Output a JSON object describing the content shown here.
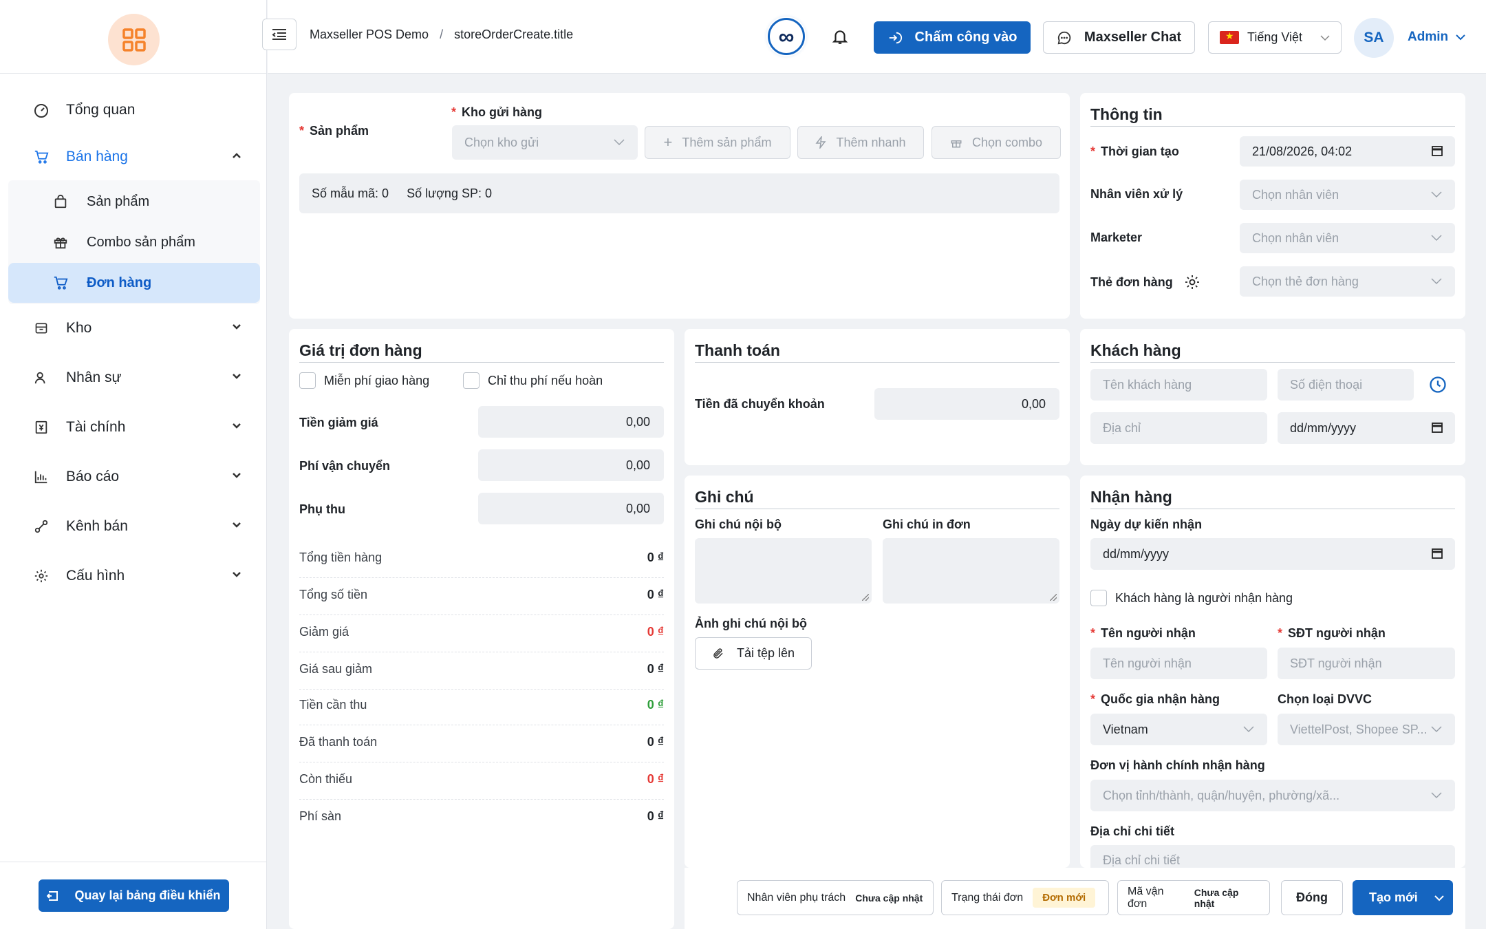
{
  "sidebar": {
    "items": [
      {
        "label": "Tổng quan",
        "icon": "dashboard-icon"
      },
      {
        "label": "Bán hàng",
        "icon": "cart-icon"
      },
      {
        "label": "Kho",
        "icon": "box-icon"
      },
      {
        "label": "Nhân sự",
        "icon": "users-icon"
      },
      {
        "label": "Tài chính",
        "icon": "finance-icon"
      },
      {
        "label": "Báo cáo",
        "icon": "chart-icon"
      },
      {
        "label": "Kênh bán",
        "icon": "channel-icon"
      },
      {
        "label": "Cấu hình",
        "icon": "gear-icon"
      }
    ],
    "sub_items": [
      {
        "label": "Sản phẩm",
        "icon": "bag-icon"
      },
      {
        "label": "Combo sản phẩm",
        "icon": "gift-icon"
      },
      {
        "label": "Đơn hàng",
        "icon": "cart-icon"
      }
    ],
    "back_label": "Quay lại bảng điều khiển"
  },
  "header": {
    "breadcrumb": [
      "Maxseller POS Demo",
      "/",
      "storeOrderCreate.title"
    ],
    "infinity": "∞",
    "checkin_label": "Chấm công vào",
    "chat_label": "Maxseller Chat",
    "language": "Tiếng Việt",
    "avatar_initials": "SA",
    "user_name": "Admin"
  },
  "product": {
    "label": "Sản phẩm",
    "warehouse_label": "Kho gửi hàng",
    "warehouse_placeholder": "Chọn kho gửi",
    "add_product": "Thêm sản phẩm",
    "quick_add": "Thêm nhanh",
    "choose_combo": "Chọn combo",
    "sku_count": "Số mẫu mã: 0",
    "qty_count": "Số lượng SP: 0"
  },
  "info": {
    "title": "Thông tin",
    "created_label": "Thời gian tạo",
    "created_value": "21/08/2026, 04:02",
    "handler_label": "Nhân viên xử lý",
    "handler_placeholder": "Chọn nhân viên",
    "marketer_label": "Marketer",
    "marketer_placeholder": "Chọn nhân viên",
    "tag_label": "Thẻ đơn hàng",
    "tag_placeholder": "Chọn thẻ đơn hàng"
  },
  "order_value": {
    "title": "Giá trị đơn hàng",
    "free_ship": "Miễn phí giao hàng",
    "charge_on_return": "Chỉ thu phí nếu hoàn",
    "discount_label": "Tiền giảm giá",
    "discount_value": "0,00",
    "shipping_label": "Phí vận chuyển",
    "shipping_value": "0,00",
    "surcharge_label": "Phụ thu",
    "surcharge_value": "0,00",
    "summary": [
      {
        "label": "Tổng tiền hàng",
        "value": "0 ₫",
        "color": "#1f2328"
      },
      {
        "label": "Tổng số tiền",
        "value": "0 ₫",
        "color": "#1f2328"
      },
      {
        "label": "Giảm giá",
        "value": "0 ₫",
        "color": "#e53935"
      },
      {
        "label": "Giá sau giảm",
        "value": "0 ₫",
        "color": "#1f2328"
      },
      {
        "label": "Tiền cần thu",
        "value": "0 ₫",
        "color": "#2e9e3a"
      },
      {
        "label": "Đã thanh toán",
        "value": "0 ₫",
        "color": "#1f2328"
      },
      {
        "label": "Còn thiếu",
        "value": "0 ₫",
        "color": "#e53935"
      },
      {
        "label": "Phí sàn",
        "value": "0 ₫",
        "color": "#1f2328"
      }
    ]
  },
  "payment": {
    "title": "Thanh toán",
    "transferred_label": "Tiền đã chuyển khoản",
    "transferred_value": "0,00"
  },
  "notes": {
    "title": "Ghi chú",
    "internal_label": "Ghi chú nội bộ",
    "print_label": "Ghi chú in đơn",
    "image_label": "Ảnh ghi chú nội bộ",
    "upload_label": "Tải tệp lên"
  },
  "customer": {
    "title": "Khách hàng",
    "name_placeholder": "Tên khách hàng",
    "phone_placeholder": "Số điện thoại",
    "address_placeholder": "Địa chỉ",
    "dob_placeholder": "dd/mm/yyyy"
  },
  "receive": {
    "title": "Nhận hàng",
    "expected_label": "Ngày dự kiến nhận",
    "expected_placeholder": "dd/mm/yyyy",
    "same_as_customer": "Khách hàng là người nhận hàng",
    "receiver_name_label": "Tên người nhận",
    "receiver_name_placeholder": "Tên người nhận",
    "receiver_phone_label": "SĐT người nhận",
    "receiver_phone_placeholder": "SĐT người nhận",
    "country_label": "Quốc gia nhận hàng",
    "country_value": "Vietnam",
    "carrier_label": "Chọn loại DVVC",
    "carrier_placeholder": "ViettelPost, Shopee SP...",
    "admin_unit_label": "Đơn vị hành chính nhận hàng",
    "admin_unit_placeholder": "Chọn tỉnh/thành, quận/huyện, phường/xã...",
    "address_detail_label": "Địa chỉ chi tiết",
    "address_detail_placeholder": "Địa chỉ chi tiết"
  },
  "footer": {
    "staff_label": "Nhân viên phụ trách",
    "staff_value": "Chưa cập nhật",
    "status_label": "Trạng thái đơn",
    "status_value": "Đơn mới",
    "tracking_label": "Mã vận đơn",
    "tracking_value": "Chưa cập nhật",
    "close_label": "Đóng",
    "create_label": "Tạo mới"
  },
  "colors": {
    "primary": "#1565c0",
    "danger": "#e53935",
    "success": "#2e9e3a",
    "logo": "#f5822a"
  }
}
